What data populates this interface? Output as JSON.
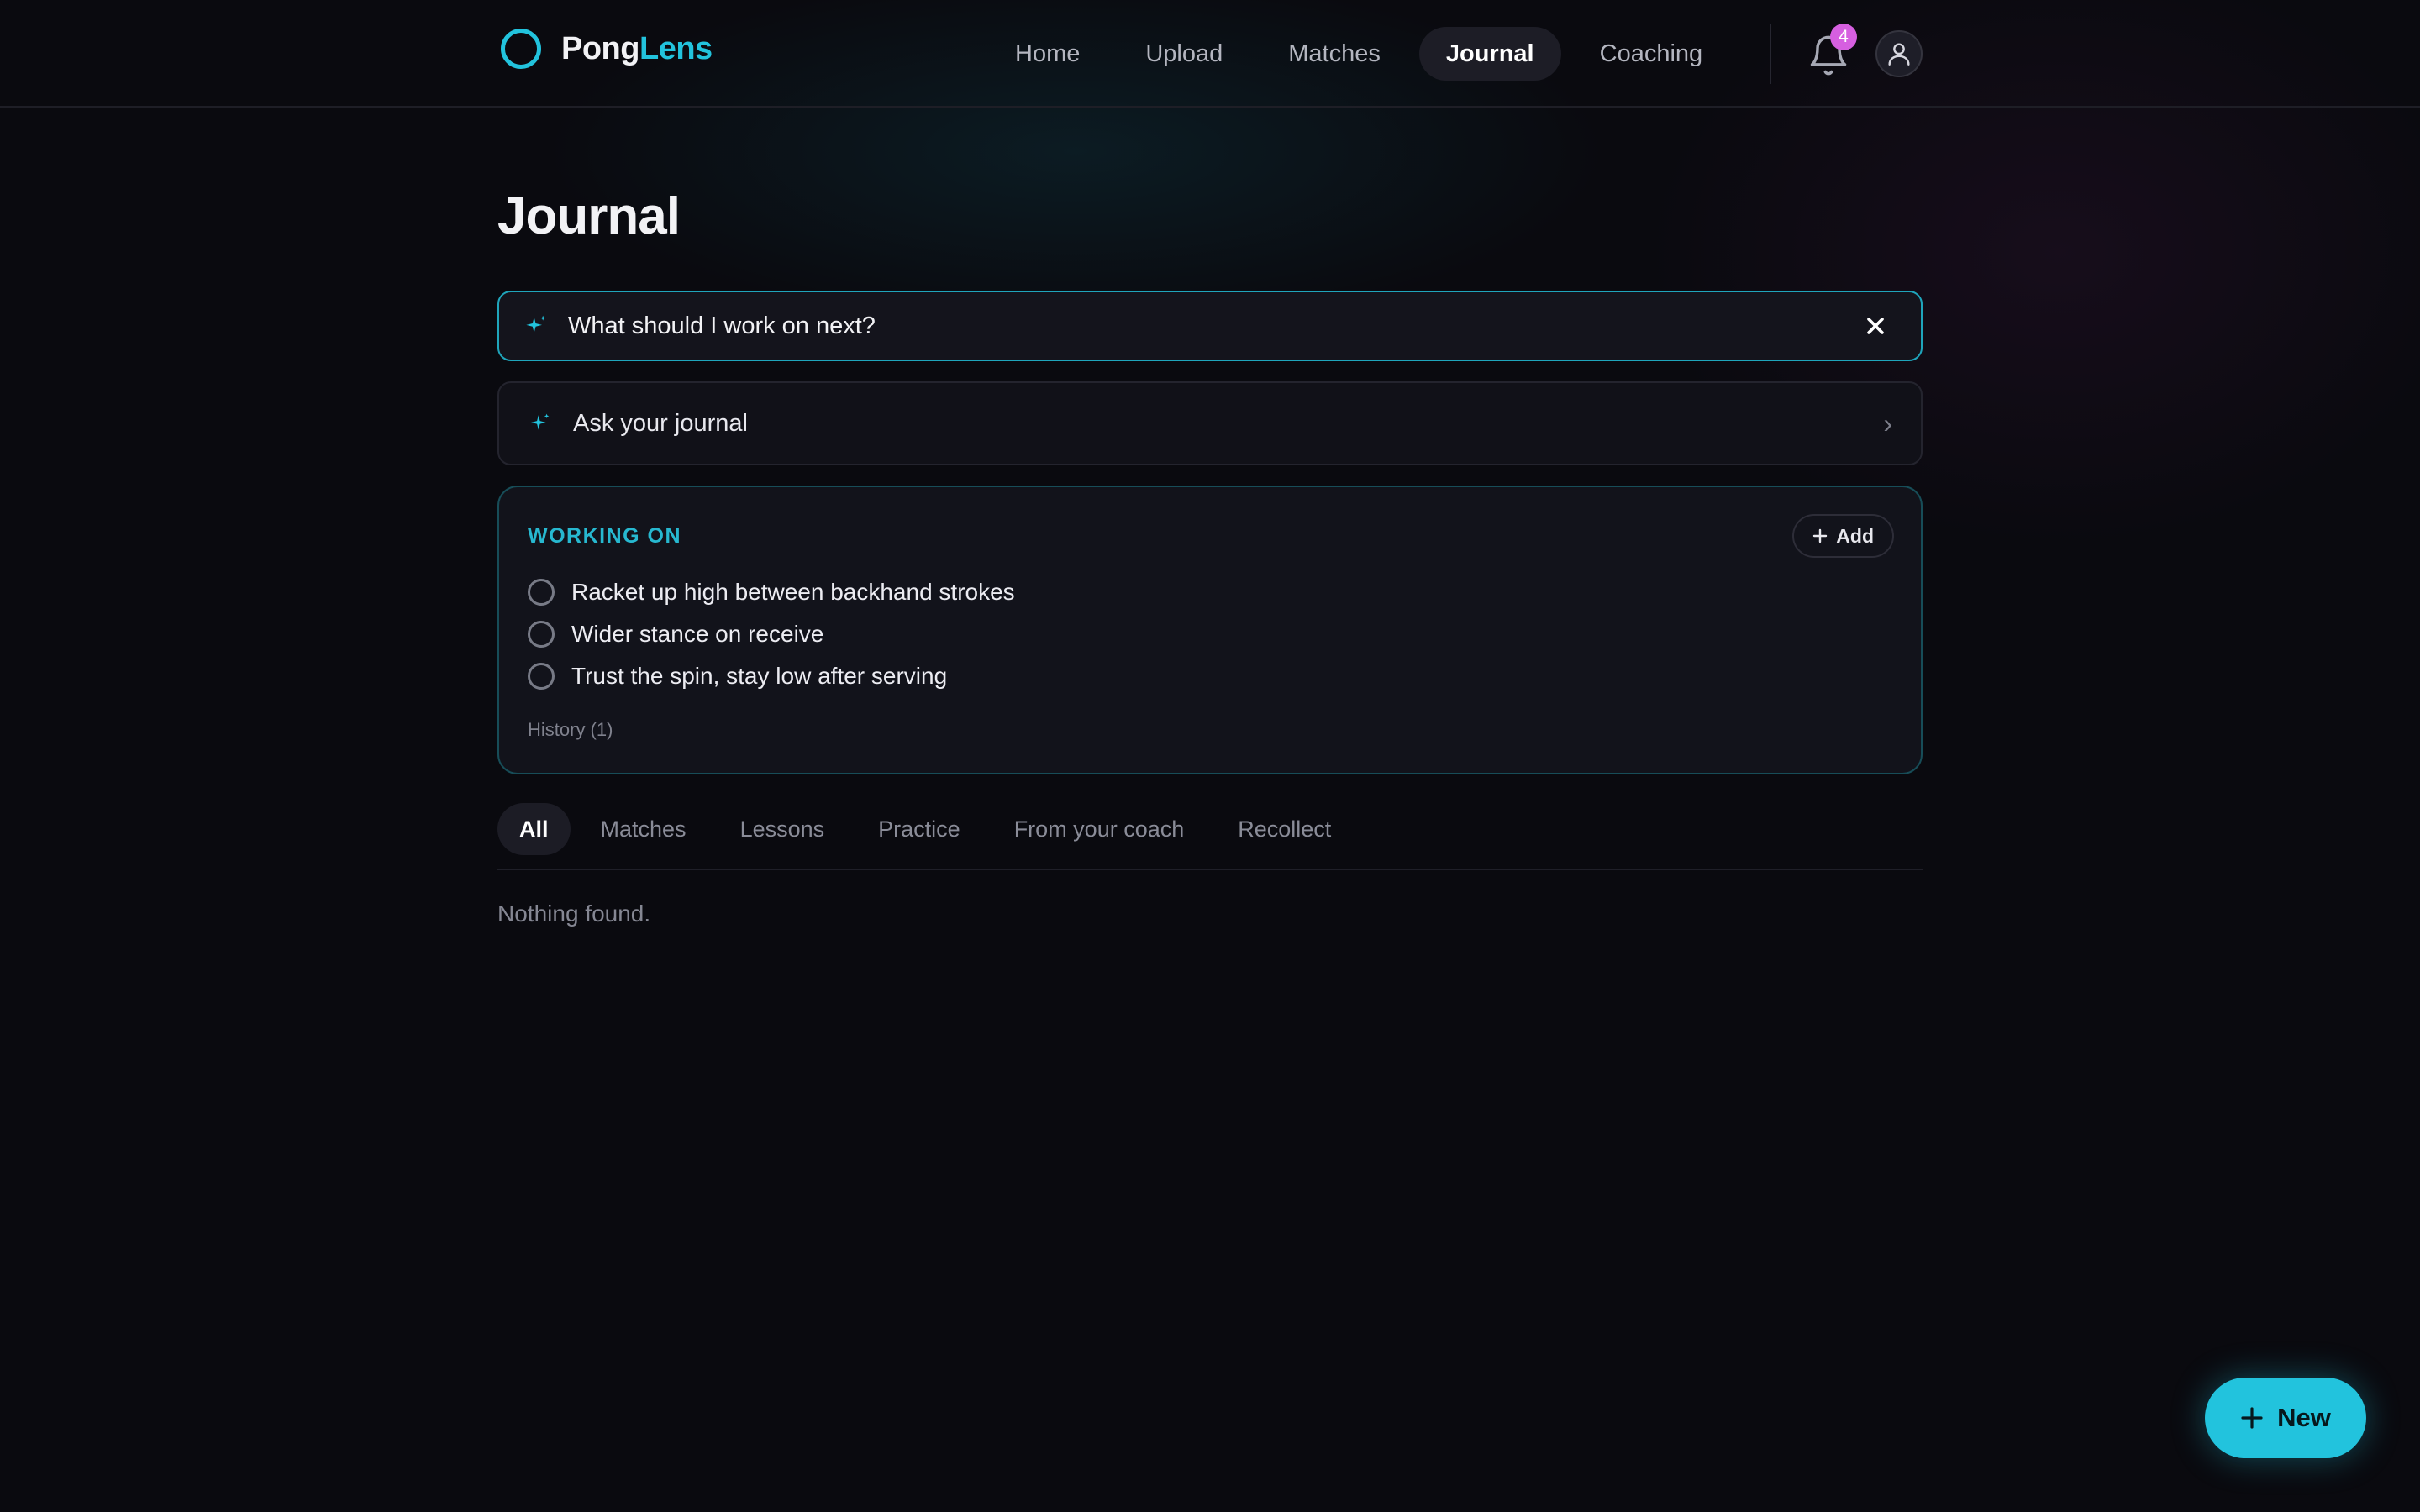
{
  "brand": {
    "name_part1": "Pong",
    "name_part2": "Lens",
    "accent_color": "#22c3dd"
  },
  "nav": {
    "items": [
      {
        "label": "Home"
      },
      {
        "label": "Upload"
      },
      {
        "label": "Matches"
      },
      {
        "label": "Journal",
        "active": true
      },
      {
        "label": "Coaching"
      }
    ],
    "notifications_count": "4",
    "notification_icon": "bell-icon",
    "avatar_icon": "user-icon",
    "badge_color": "#d65fe0"
  },
  "page": {
    "title": "Journal"
  },
  "search": {
    "value": "What should I work on next?",
    "icon": "sparkle-icon",
    "clear_icon": "close-icon"
  },
  "ask": {
    "label": "Ask your journal",
    "icon": "sparkle-icon",
    "chevron": "›"
  },
  "working_on": {
    "title": "WORKING ON",
    "add_label": "Add",
    "goals": [
      {
        "text": "Racket up high between backhand strokes",
        "done": false
      },
      {
        "text": "Wider stance on receive",
        "done": false
      },
      {
        "text": "Trust the spin, stay low after serving",
        "done": false
      }
    ],
    "history_label": "History (1)"
  },
  "filters": {
    "tabs": [
      {
        "label": "All",
        "active": true
      },
      {
        "label": "Matches"
      },
      {
        "label": "Lessons"
      },
      {
        "label": "Practice"
      },
      {
        "label": "From your coach"
      },
      {
        "label": "Recollect"
      }
    ]
  },
  "empty_state": "Nothing found.",
  "fab": {
    "label": "New",
    "icon": "plus-icon"
  }
}
